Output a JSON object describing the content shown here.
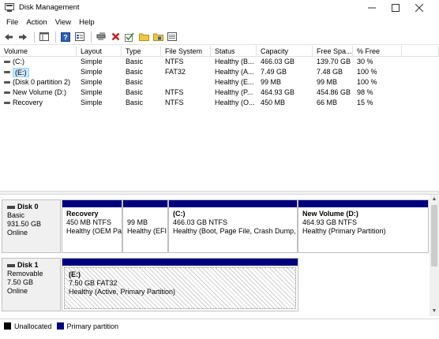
{
  "window": {
    "title": "Disk Management"
  },
  "menu": [
    "File",
    "Action",
    "View",
    "Help"
  ],
  "toolbar": {
    "buttons": [
      "back-icon",
      "forward-icon",
      "show-hide-tree-icon",
      "help-icon",
      "properties-icon",
      "connect-icon",
      "delete-icon",
      "check-icon",
      "open-folder-icon",
      "explore-folder-icon",
      "console-view-icon"
    ]
  },
  "volume_list": {
    "columns": [
      "Volume",
      "Layout",
      "Type",
      "File System",
      "Status",
      "Capacity",
      "Free Spa...",
      "% Free"
    ],
    "rows": [
      {
        "volume": "(C:)",
        "layout": "Simple",
        "type": "Basic",
        "fs": "NTFS",
        "status": "Healthy (B...",
        "capacity": "466.03 GB",
        "free": "139.70 GB",
        "pct": "30 %",
        "selected": false
      },
      {
        "volume": "(E:)",
        "layout": "Simple",
        "type": "Basic",
        "fs": "FAT32",
        "status": "Healthy (A...",
        "capacity": "7.49 GB",
        "free": "7.48 GB",
        "pct": "100 %",
        "selected": true
      },
      {
        "volume": "(Disk 0 partition 2)",
        "layout": "Simple",
        "type": "Basic",
        "fs": "",
        "status": "Healthy (E...",
        "capacity": "99 MB",
        "free": "99 MB",
        "pct": "100 %",
        "selected": false
      },
      {
        "volume": "New Volume (D:)",
        "layout": "Simple",
        "type": "Basic",
        "fs": "NTFS",
        "status": "Healthy (P...",
        "capacity": "464.93 GB",
        "free": "454.86 GB",
        "pct": "98 %",
        "selected": false
      },
      {
        "volume": "Recovery",
        "layout": "Simple",
        "type": "Basic",
        "fs": "NTFS",
        "status": "Healthy (O...",
        "capacity": "450 MB",
        "free": "66 MB",
        "pct": "15 %",
        "selected": false
      }
    ]
  },
  "disks": [
    {
      "name": "Disk 0",
      "kind": "Basic",
      "size": "931.50 GB",
      "state": "Online",
      "partitions": [
        {
          "name": "Recovery",
          "size": "450 MB NTFS",
          "status": "Healthy (OEM Pa"
        },
        {
          "name": "",
          "size": "99 MB",
          "status": "Healthy (EFI"
        },
        {
          "name": "(C:)",
          "size": "466.03 GB NTFS",
          "status": "Healthy (Boot, Page File, Crash Dump,"
        },
        {
          "name": "New Volume  (D:)",
          "size": "464.93 GB NTFS",
          "status": "Healthy (Primary Partition)"
        }
      ]
    },
    {
      "name": "Disk 1",
      "kind": "Removable",
      "size": "7.50 GB",
      "state": "Online",
      "partitions": [
        {
          "name": "(E:)",
          "size": "7.50 GB FAT32",
          "status": "Healthy (Active, Primary Partition)"
        }
      ]
    }
  ],
  "legend": [
    {
      "label": "Unallocated",
      "color": "#000000"
    },
    {
      "label": "Primary partition",
      "color": "#00007f"
    }
  ]
}
